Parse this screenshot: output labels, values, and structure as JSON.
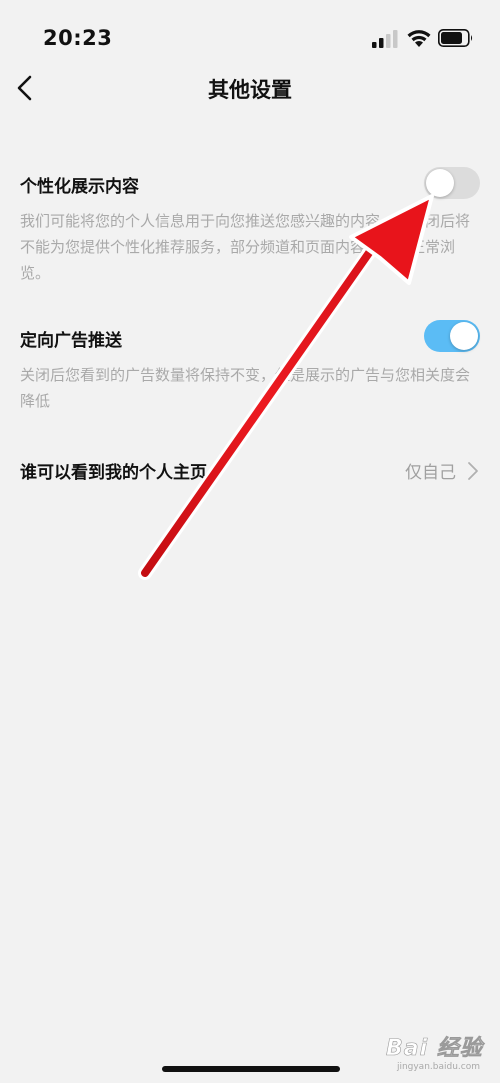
{
  "status_bar": {
    "time": "20:23"
  },
  "nav": {
    "title": "其他设置"
  },
  "settings": {
    "personalized": {
      "label": "个性化展示内容",
      "description": "我们可能将您的个人信息用于向您推送您感兴趣的内容。您关闭后将不能为您提供个性化推荐服务，部分频道和页面内容将无法正常浏览。",
      "enabled": false
    },
    "targeted_ads": {
      "label": "定向广告推送",
      "description": "关闭后您看到的广告数量将保持不变，但是展示的广告与您相关度会降低",
      "enabled": true
    },
    "profile_visibility": {
      "label": "谁可以看到我的个人主页",
      "value": "仅自己"
    }
  },
  "colors": {
    "background": "#f2f2f2",
    "toggle_on": "#5bbcf5",
    "toggle_off": "#dcdcdc",
    "annotation_arrow": "#e8141b"
  },
  "watermark": {
    "main": "Bai 经验",
    "sub": "jingyan.baidu.com"
  }
}
